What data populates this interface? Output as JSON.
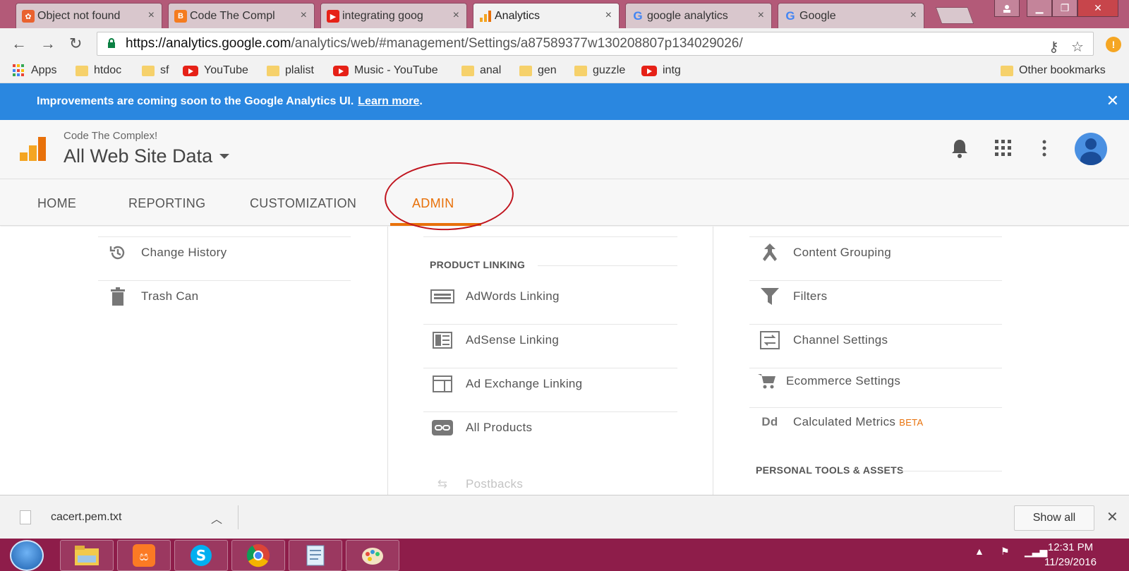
{
  "browser": {
    "tabs": [
      {
        "title": "Object not found",
        "favicon": "xampp-icon",
        "color": "#e9622f"
      },
      {
        "title": "Code The Compl",
        "favicon": "blogger-icon",
        "color": "#f57c1f"
      },
      {
        "title": "integrating goog",
        "favicon": "youtube-icon",
        "color": "#e62117"
      },
      {
        "title": "Analytics",
        "favicon": "analytics-icon",
        "color": "#f4a522"
      },
      {
        "title": "google analytics",
        "favicon": "google-icon",
        "color": "#4285f4"
      },
      {
        "title": "Google",
        "favicon": "google-icon",
        "color": "#4285f4"
      }
    ],
    "tab_close": "×",
    "url_host": "https://analytics.google.com",
    "url_path": "/analytics/web/#management/Settings/a87589377w130208807p134029026/",
    "bookmarks": [
      {
        "label": "Apps",
        "type": "apps"
      },
      {
        "label": "htdoc",
        "type": "folder"
      },
      {
        "label": "sf",
        "type": "folder"
      },
      {
        "label": "YouTube",
        "type": "youtube"
      },
      {
        "label": "plalist",
        "type": "folder"
      },
      {
        "label": "Music - YouTube",
        "type": "youtube"
      },
      {
        "label": "anal",
        "type": "folder"
      },
      {
        "label": "gen",
        "type": "folder"
      },
      {
        "label": "guzzle",
        "type": "folder"
      },
      {
        "label": "intg",
        "type": "youtube"
      }
    ],
    "other_bookmarks": "Other bookmarks"
  },
  "banner": {
    "text": "Improvements are coming soon to the Google Analytics UI.",
    "link": "Learn more",
    "period": "."
  },
  "header": {
    "account": "Code The Complex!",
    "view": "All Web Site Data"
  },
  "nav": {
    "tabs": [
      "HOME",
      "REPORTING",
      "CUSTOMIZATION",
      "ADMIN"
    ],
    "active": "ADMIN",
    "accent": "#e8710a"
  },
  "admin": {
    "account_col": [
      {
        "label": "Change History",
        "icon": "history-icon"
      },
      {
        "label": "Trash Can",
        "icon": "trash-icon"
      }
    ],
    "property_col": {
      "section": "PRODUCT LINKING",
      "items": [
        {
          "label": "AdWords Linking",
          "icon": "adwords-icon"
        },
        {
          "label": "AdSense Linking",
          "icon": "adsense-icon"
        },
        {
          "label": "Ad Exchange Linking",
          "icon": "ad-exchange-icon"
        },
        {
          "label": "All Products",
          "icon": "link-icon"
        }
      ],
      "cut_off": "Postbacks"
    },
    "view_col": {
      "items": [
        {
          "label": "Content Grouping",
          "icon": "content-grouping-icon"
        },
        {
          "label": "Filters",
          "icon": "filter-icon"
        },
        {
          "label": "Channel Settings",
          "icon": "channel-settings-icon"
        },
        {
          "label": "Ecommerce Settings",
          "icon": "cart-icon"
        },
        {
          "label": "Calculated Metrics",
          "icon": "dd-icon",
          "badge": "BETA"
        }
      ],
      "section": "PERSONAL TOOLS & ASSETS"
    }
  },
  "downloads": {
    "file": "cacert.pem.txt",
    "show_all": "Show all"
  },
  "taskbar": {
    "time": "12:31 PM",
    "date": "11/29/2016"
  }
}
